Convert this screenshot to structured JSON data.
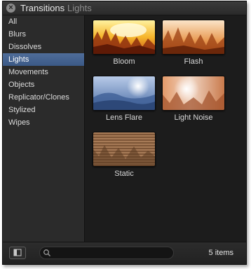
{
  "window": {
    "title": "Transitions",
    "subtitle": "Lights"
  },
  "sidebar": {
    "items": [
      {
        "label": "All"
      },
      {
        "label": "Blurs"
      },
      {
        "label": "Dissolves"
      },
      {
        "label": "Lights",
        "selected": true
      },
      {
        "label": "Movements"
      },
      {
        "label": "Objects"
      },
      {
        "label": "Replicator/Clones"
      },
      {
        "label": "Stylized"
      },
      {
        "label": "Wipes"
      }
    ]
  },
  "content": {
    "tiles": [
      {
        "label": "Bloom"
      },
      {
        "label": "Flash"
      },
      {
        "label": "Lens Flare"
      },
      {
        "label": "Light Noise"
      },
      {
        "label": "Static"
      }
    ]
  },
  "footer": {
    "search_placeholder": "",
    "item_count": "5 items"
  },
  "icons": {
    "close": "close-icon",
    "sidebar_toggle": "sidebar-toggle-icon",
    "search": "search-icon"
  },
  "colors": {
    "selection": "#4a6897",
    "window_bg": "#1f1f1f"
  }
}
